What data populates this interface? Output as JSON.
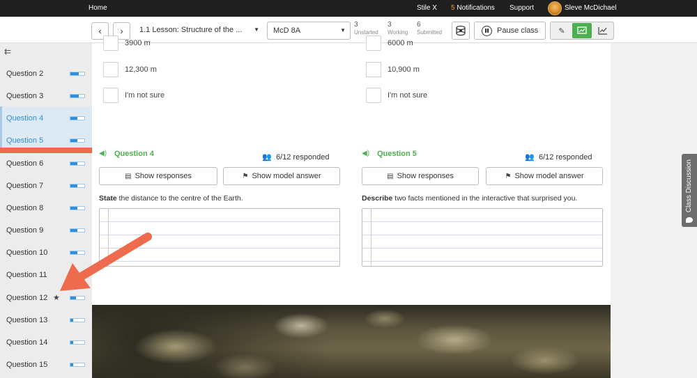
{
  "topbar": {
    "home": "Home",
    "stile": "Stile X",
    "notif_count": "5",
    "notif_label": "Notifications",
    "support": "Support",
    "user": "Sleve McDichael"
  },
  "toolbar": {
    "prev_icon": "chevron-left-icon",
    "next_icon": "chevron-right-icon",
    "lesson": "1.1 Lesson: Structure of the ...",
    "class": "McD 8A",
    "stats": [
      {
        "value": "3",
        "label": "Unstarted"
      },
      {
        "value": "3",
        "label": "Working"
      },
      {
        "value": "6",
        "label": "Submitted"
      }
    ],
    "pause": "Pause class",
    "modes": [
      "pencil-icon",
      "present-icon",
      "chart-icon"
    ]
  },
  "sidebar": {
    "items": [
      {
        "label": "Question 2",
        "progress": 0.6
      },
      {
        "label": "Question 3",
        "progress": 0.6
      },
      {
        "label": "Question 4",
        "progress": 0.5
      },
      {
        "label": "Question 5",
        "progress": 0.5
      },
      {
        "label": "Question 6",
        "progress": 0.5
      },
      {
        "label": "Question 7",
        "progress": 0.5
      },
      {
        "label": "Question 8",
        "progress": 0.5
      },
      {
        "label": "Question 9",
        "progress": 0.5
      },
      {
        "label": "Question 10",
        "progress": 0.5
      },
      {
        "label": "Question 11",
        "progress": 0.5
      },
      {
        "label": "Question 12",
        "progress": 0.4
      },
      {
        "label": "Question 13",
        "progress": 0.2
      },
      {
        "label": "Question 14",
        "progress": 0.2
      },
      {
        "label": "Question 15",
        "progress": 0.2
      }
    ]
  },
  "main": {
    "left_options": [
      "3900 m",
      "12,300 m",
      "I'm not sure"
    ],
    "right_options": [
      "6000 m",
      "10,900 m",
      "I'm not sure"
    ],
    "q4": {
      "title": "Question 4",
      "responded": "6/12 responded",
      "show_responses": "Show responses",
      "show_model": "Show model answer",
      "prompt_bold": "State",
      "prompt_rest": " the distance to the centre of the Earth."
    },
    "q5": {
      "title": "Question 5",
      "responded": "6/12 responded",
      "show_responses": "Show responses",
      "show_model": "Show model answer",
      "prompt_bold": "Describe",
      "prompt_rest": " two facts mentioned in the interactive that surprised you."
    }
  },
  "right_rail": {
    "class_discussion": "Class Discussion"
  },
  "colors": {
    "accent_green": "#4caf50",
    "accent_blue": "#2f8fd8",
    "annotation_orange": "#ee6b4d"
  }
}
